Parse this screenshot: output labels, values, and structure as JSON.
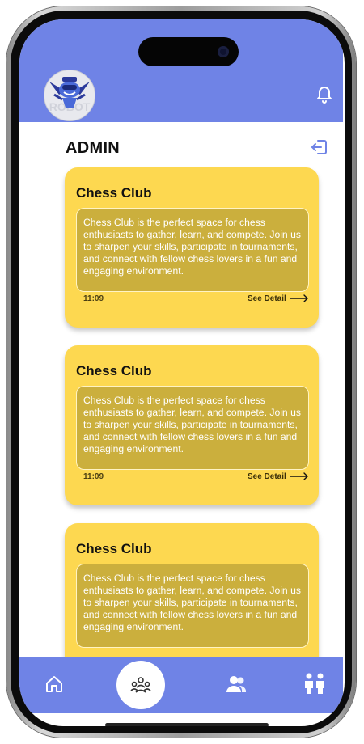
{
  "header": {
    "title": "ADMIN",
    "logo_icon": "robot-mascot-logo",
    "bell_icon": "bell-icon",
    "logout_icon": "logout-icon"
  },
  "cards": [
    {
      "title": "Chess Club",
      "description": "Chess Club is the perfect space for chess enthusiasts to gather, learn, and compete. Join us to sharpen your skills, participate in tournaments, and connect with fellow chess lovers in a fun and engaging environment.",
      "time": "11:09",
      "detail_label": "See Detail"
    },
    {
      "title": "Chess Club",
      "description": "Chess Club is the perfect space for chess enthusiasts to gather, learn, and compete. Join us to sharpen your skills, participate in tournaments, and connect with fellow chess lovers in a fun and engaging environment.",
      "time": "11:09",
      "detail_label": "See Detail"
    },
    {
      "title": "Chess Club",
      "description": "Chess Club is the perfect space for chess enthusiasts to gather, learn, and compete. Join us to sharpen your skills, participate in tournaments, and connect with fellow chess lovers in a fun and engaging environment."
    }
  ],
  "nav": {
    "items": [
      "home-icon",
      "community-icon",
      "users-icon",
      "people-icon"
    ],
    "active": "community-icon"
  },
  "colors": {
    "primary": "#6f83e6",
    "card": "#fdd850",
    "card_desc_bg": "#cbaf3d",
    "text": "#111111"
  }
}
